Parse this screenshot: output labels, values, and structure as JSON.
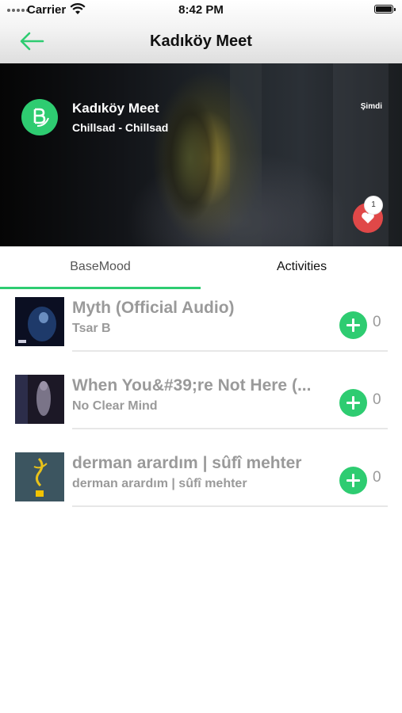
{
  "status": {
    "carrier": "Carrier",
    "time": "8:42 PM"
  },
  "nav": {
    "title": "Kadıköy Meet",
    "back_icon": "arrow-left-icon",
    "accent": "#2ecc71"
  },
  "room": {
    "name": "Kadıköy Meet",
    "subtitle": "Chillsad - Chillsad",
    "time_label": "Şimdi",
    "like_count": "1",
    "like_color": "#e04848"
  },
  "tabs": [
    {
      "label": "BaseMood",
      "selected": true
    },
    {
      "label": "Activities",
      "selected": false
    }
  ],
  "tracks": [
    {
      "title": "Myth (Official Audio)",
      "artist": "Tsar B",
      "count": "0"
    },
    {
      "title": "When You&#39;re Not Here (...",
      "artist": "No Clear Mind",
      "count": "0"
    },
    {
      "title": "derman arardım | sûfî mehter",
      "artist": "derman arardım | sûfî mehter",
      "count": "0"
    }
  ]
}
